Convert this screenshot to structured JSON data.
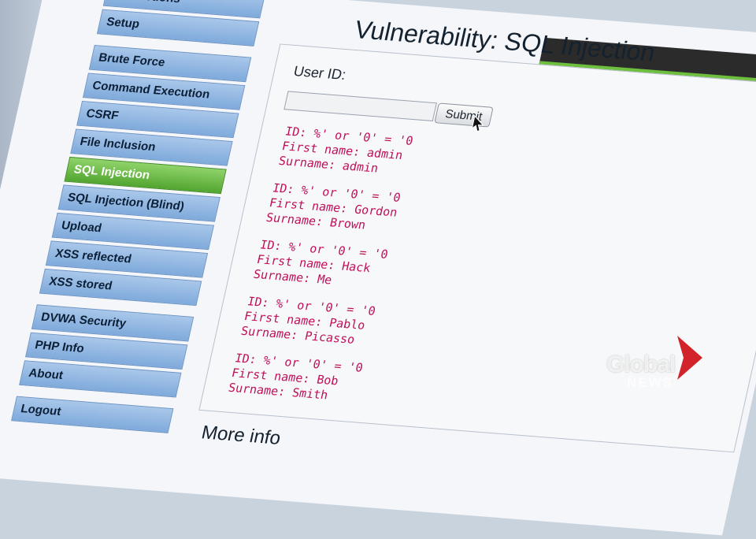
{
  "sidebar": {
    "groups": [
      {
        "items": [
          {
            "label": "Instructions"
          },
          {
            "label": "Setup"
          }
        ]
      },
      {
        "items": [
          {
            "label": "Brute Force"
          },
          {
            "label": "Command Execution"
          },
          {
            "label": "CSRF"
          },
          {
            "label": "File Inclusion"
          },
          {
            "label": "SQL Injection",
            "active": true
          },
          {
            "label": "SQL Injection (Blind)"
          },
          {
            "label": "Upload"
          },
          {
            "label": "XSS reflected"
          },
          {
            "label": "XSS stored"
          }
        ]
      },
      {
        "items": [
          {
            "label": "DVWA Security"
          },
          {
            "label": "PHP Info"
          },
          {
            "label": "About"
          }
        ]
      },
      {
        "items": [
          {
            "label": "Logout"
          }
        ]
      }
    ]
  },
  "page": {
    "title": "Vulnerability: SQL Injection",
    "form": {
      "label": "User ID:",
      "input_value": "",
      "submit_label": "Submit"
    },
    "results": [
      {
        "id": "ID: %' or '0' = '0",
        "first": "First name: admin",
        "surname": "Surname: admin"
      },
      {
        "id": "ID: %' or '0' = '0",
        "first": "First name: Gordon",
        "surname": "Surname: Brown"
      },
      {
        "id": "ID: %' or '0' = '0",
        "first": "First name: Hack",
        "surname": "Surname: Me"
      },
      {
        "id": "ID: %' or '0' = '0",
        "first": "First name: Pablo",
        "surname": "Surname: Picasso"
      },
      {
        "id": "ID: %' or '0' = '0",
        "first": "First name: Bob",
        "surname": "Surname: Smith"
      }
    ],
    "more_info": "More info"
  },
  "watermark": {
    "line1": "Global",
    "line2": "NEWS"
  },
  "colors": {
    "active_menu": "#52a530",
    "menu": "#7faadb",
    "result_text": "#c0105a",
    "watermark_chevron": "#d2232a"
  }
}
